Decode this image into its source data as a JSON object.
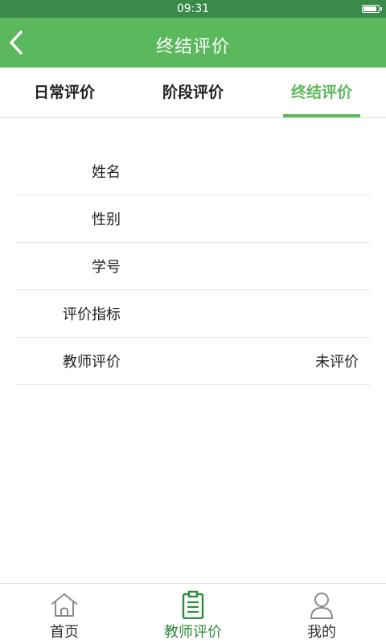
{
  "status_bar": {
    "time": "09:31"
  },
  "header": {
    "title": "终结评价",
    "back_icon": "chevron-left-icon"
  },
  "tabs": [
    {
      "label": "日常评价",
      "active": false
    },
    {
      "label": "阶段评价",
      "active": false
    },
    {
      "label": "终结评价",
      "active": true
    }
  ],
  "form": {
    "rows": [
      {
        "label": "姓名",
        "value": ""
      },
      {
        "label": "性别",
        "value": ""
      },
      {
        "label": "学号",
        "value": ""
      },
      {
        "label": "评价指标",
        "value": ""
      },
      {
        "label": "教师评价",
        "value": "未评价"
      }
    ]
  },
  "bottom_nav": {
    "items": [
      {
        "label": "首页",
        "icon": "home-icon",
        "active": false
      },
      {
        "label": "教师评价",
        "icon": "clipboard-icon",
        "active": true
      },
      {
        "label": "我的",
        "icon": "user-icon",
        "active": false
      }
    ]
  },
  "colors": {
    "accent": "#5cb85c",
    "status_bar": "#3a8a4a",
    "active_nav": "#2e8b3e"
  }
}
